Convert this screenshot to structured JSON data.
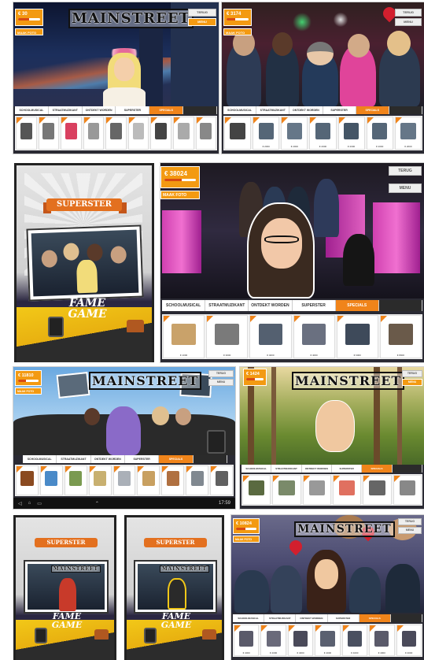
{
  "shot1": {
    "hud_value": "€ 30",
    "hud_progress": 0.5,
    "photo_label": "MAAK FOTO",
    "menu": [
      "TERUG",
      "MENU"
    ],
    "logo": "MAINSTREET",
    "tabs": [
      "SCHOOLMUSICAL",
      "STRAATMUZIKANT",
      "ONTDEKT WORDEN",
      "SUPERSTER",
      "SPECIALS",
      ""
    ],
    "active_tab": 4,
    "items": [
      "",
      "",
      "",
      "",
      "",
      "",
      "",
      "",
      ""
    ],
    "item_colors": [
      "#555555",
      "#777777",
      "#d94060",
      "#999999",
      "#666666",
      "#bbbbbb",
      "#444444",
      "#aaaaaa",
      "#888888"
    ]
  },
  "shot2": {
    "hud_value": "€ 3174",
    "hud_progress": 0.4,
    "photo_label": "MAAK FOTO",
    "menu": [
      "TERUG",
      "MENU"
    ],
    "tabs": [
      "SCHOOLMUSICAL",
      "STRAATMUZIKANT",
      "ONTDEKT WORDEN",
      "SUPERSTER",
      "SPECIALS",
      ""
    ],
    "active_tab": 4,
    "items": [
      "",
      "€ 2000",
      "€ 2000",
      "€ 2000",
      "€ 2000",
      "€ 2000",
      "€ 2000"
    ],
    "item_colors": [
      "#444444",
      "#556677",
      "#667788",
      "#556677",
      "#445566",
      "#556677",
      "#667788"
    ]
  },
  "shot3": {
    "ribbon": "SUPERSTER",
    "fame_line1": "FAME",
    "fame_line2": "GAME"
  },
  "shot4": {
    "hud_value": "€ 38024",
    "hud_progress": 0.55,
    "photo_label": "MAAK FOTO",
    "menu": [
      "TERUG",
      "MENU"
    ],
    "tabs": [
      "SCHOOLMUSICAL",
      "STRAATMUZIKANT",
      "ONTDEKT WORDEN",
      "SUPERSTER",
      "SPECIALS",
      ""
    ],
    "active_tab": 4,
    "items": [
      "€ 1000",
      "€ 3000",
      "€ 4000",
      "€ 4000",
      "€ 6000",
      "€ 8000"
    ],
    "item_colors": [
      "#c9a26a",
      "#7a7a7a",
      "#546070",
      "#6a7080",
      "#3e4a5a",
      "#6a5a4a"
    ]
  },
  "shot5": {
    "hud_value": "€ 11810",
    "hud_progress": 0.4,
    "photo_label": "MAAK FOTO",
    "menu": [
      "TERUG",
      "MENU"
    ],
    "logo": "MAINSTREET",
    "tabs": [
      "SCHOOLMUSICAL",
      "STRAATMUZIKANT",
      "ONTDEKT WORDEN",
      "SUPERSTER",
      "SPECIALS",
      ""
    ],
    "active_tab": 4,
    "items": [
      "",
      "",
      "",
      "",
      "",
      "",
      "",
      "",
      ""
    ],
    "item_colors": [
      "#8a4a20",
      "#4a8ac8",
      "#7a9a50",
      "#c8b070",
      "#aab0b8",
      "#c8a060",
      "#b07040",
      "#808890",
      "#606060"
    ],
    "status_time": "17:59"
  },
  "shot6": {
    "hud_value": "€ 1424",
    "hud_progress": 0.5,
    "menu": [
      "TERUG",
      "MENU"
    ],
    "logo": "MAINSTREET",
    "tabs": [
      "SCHOOLMUSICAL",
      "STRAATMUZIKANT",
      "ONTDEKT WORDEN",
      "SUPERSTER",
      "SPECIALS",
      ""
    ],
    "active_tab": 4,
    "items": [
      "",
      "",
      "",
      "",
      "",
      ""
    ],
    "item_colors": [
      "#5a6a40",
      "#7a8a6a",
      "#999999",
      "#e07060",
      "#666666",
      "#888888"
    ]
  },
  "shot7": {
    "ribbon": "SUPERSTER",
    "logo": "MAINSTREET",
    "fame_line1": "FAME",
    "fame_line2": "GAME"
  },
  "shot8": {
    "ribbon": "SUPERSTER",
    "logo": "MAINSTREET",
    "fame_line1": "FAME",
    "fame_line2": "GAME"
  },
  "shot9": {
    "hud_value": "€ 10824",
    "hud_progress": 0.45,
    "photo_label": "MAAK FOTO",
    "menu": [
      "TERUG",
      "MENU"
    ],
    "logo": "MAINSTREET",
    "tabs": [
      "SCHOOLMUSICAL",
      "STRAATMUZIKANT",
      "ONTDEKT WORDEN",
      "SUPERSTER",
      "SPECIALS",
      ""
    ],
    "active_tab": 4,
    "items": [
      "€ 4000",
      "€ 4000",
      "€ 4000",
      "€ 4000",
      "€ 4000",
      "€ 4000",
      "€ 4000"
    ],
    "item_colors": [
      "#5a5a6a",
      "#6a6a7a",
      "#4a4a5a",
      "#5a6070",
      "#4a5060",
      "#5a5a6a",
      "#4a4a5a"
    ]
  },
  "colors": {
    "orange": "#f39a12",
    "tab_active": "#f0841a",
    "dark": "#2b2b2b"
  }
}
